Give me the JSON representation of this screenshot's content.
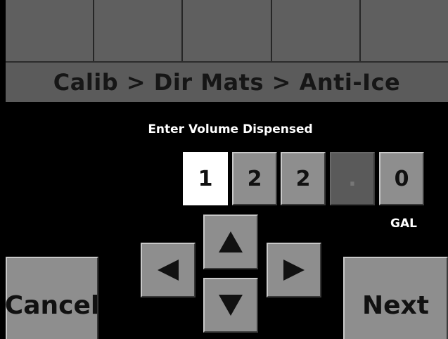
{
  "top_bar": {
    "keys": [
      "",
      "",
      "",
      "",
      ""
    ]
  },
  "breadcrumb": {
    "text": "Calib > Dir Mats > Anti-Ice"
  },
  "entry": {
    "prompt": "Enter Volume Dispensed",
    "digits": [
      "1",
      "2",
      "2",
      ".",
      "0"
    ],
    "selected_index": 0,
    "unit": "GAL"
  },
  "arrows": {
    "up_icon": "arrow-up-icon",
    "down_icon": "arrow-down-icon",
    "left_icon": "arrow-left-icon",
    "right_icon": "arrow-right-icon"
  },
  "buttons": {
    "cancel_label": "Cancel",
    "next_label": "Next"
  },
  "colors": {
    "background": "#000000",
    "bar": "#5f5f5f",
    "key": "#8e8e8e",
    "selected_digit": "#ffffff",
    "text_dark": "#111111",
    "text_light": "#ffffff"
  }
}
